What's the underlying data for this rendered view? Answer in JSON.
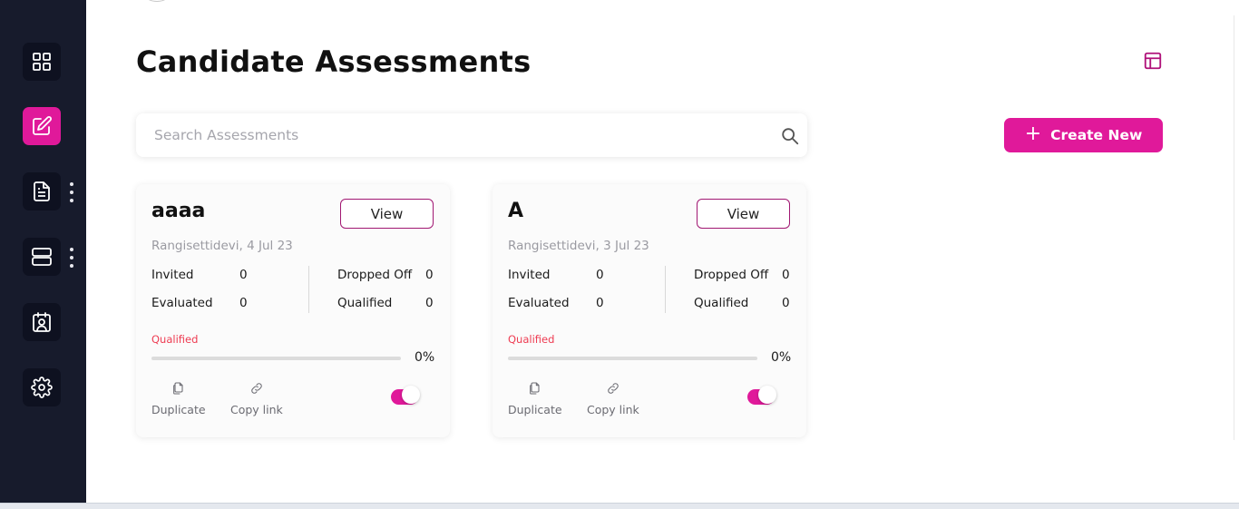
{
  "sidebar": {
    "items": [
      {
        "icon": "dashboard-grid-icon",
        "active": false
      },
      {
        "icon": "edit-icon",
        "active": true
      },
      {
        "icon": "document-icon",
        "active": false,
        "has_menu": true
      },
      {
        "icon": "server-icon",
        "active": false,
        "has_menu": true
      },
      {
        "icon": "contact-card-icon",
        "active": false
      },
      {
        "icon": "gear-icon",
        "active": false
      }
    ]
  },
  "page": {
    "title": "Candidate Assessments",
    "layout_icon": "layout-icon"
  },
  "search": {
    "placeholder": "Search Assessments",
    "value": "",
    "icon": "search-icon"
  },
  "create_button": {
    "icon": "+",
    "label": "Create New"
  },
  "cards": [
    {
      "title": "aaaa",
      "view_label": "View",
      "meta": "Rangisettidevi, 4 Jul 23",
      "stats": {
        "invited_label": "Invited",
        "invited": "0",
        "evaluated_label": "Evaluated",
        "evaluated": "0",
        "dropped_label": "Dropped Off",
        "dropped": "0",
        "qualified_label": "Qualified",
        "qualified": "0"
      },
      "progress_label": "Qualified",
      "progress_percent": 0,
      "progress_text": "0%",
      "duplicate_label": "Duplicate",
      "copy_label": "Copy link",
      "active": true
    },
    {
      "title": "A",
      "view_label": "View",
      "meta": "Rangisettidevi, 3 Jul 23",
      "stats": {
        "invited_label": "Invited",
        "invited": "0",
        "evaluated_label": "Evaluated",
        "evaluated": "0",
        "dropped_label": "Dropped Off",
        "dropped": "0",
        "qualified_label": "Qualified",
        "qualified": "0"
      },
      "progress_label": "Qualified",
      "progress_percent": 0,
      "progress_text": "0%",
      "duplicate_label": "Duplicate",
      "copy_label": "Copy link",
      "active": true
    }
  ],
  "colors": {
    "sidebar_bg": "#171b2c",
    "accent": "#e0199a",
    "qualified_text": "#ee3c52"
  }
}
